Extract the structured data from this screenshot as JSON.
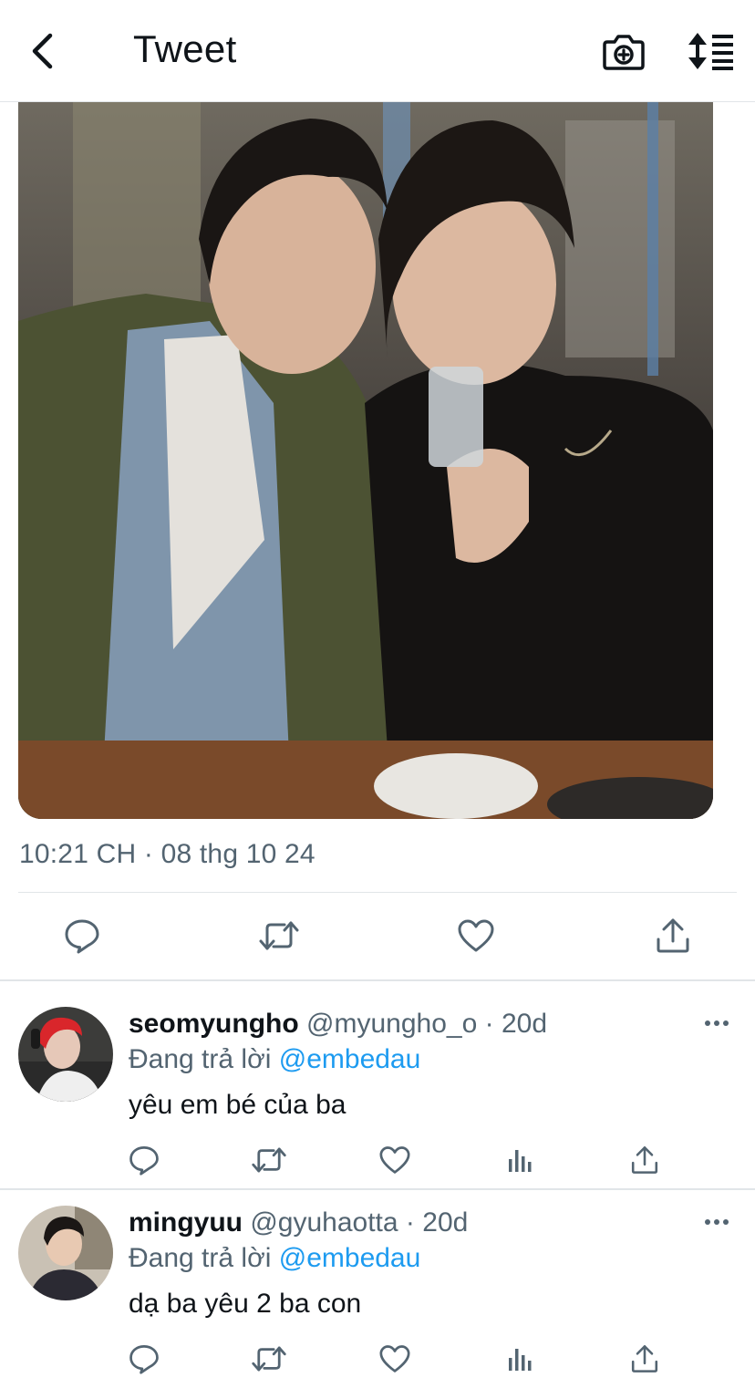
{
  "header": {
    "title": "Tweet",
    "back_icon": "chevron-left-icon",
    "camera_icon": "camera-plus-icon",
    "sort_icon": "sort-list-icon"
  },
  "tweet": {
    "timestamp": "10:21 CH · 08 thg 10 24",
    "photo_icon": "photo-image",
    "actions": [
      "reply-icon",
      "retweet-icon",
      "like-icon",
      "share-icon"
    ]
  },
  "replies": [
    {
      "name": "seomyungho",
      "handle": "@myungho_o",
      "dot": "·",
      "age": "20d",
      "replying_prefix": "Đang trả lời",
      "replying_to": "@embedau",
      "text": "yêu em bé của ba"
    },
    {
      "name": "mingyuu",
      "handle": "@gyuhaotta",
      "dot": "·",
      "age": "20d",
      "replying_prefix": "Đang trả lời",
      "replying_to": "@embedau",
      "text": "dạ ba yêu 2 ba con"
    }
  ],
  "colors": {
    "text": "#0f1419",
    "secondary": "#536471",
    "link": "#1d9bf0",
    "divider": "#e1e5e8"
  }
}
